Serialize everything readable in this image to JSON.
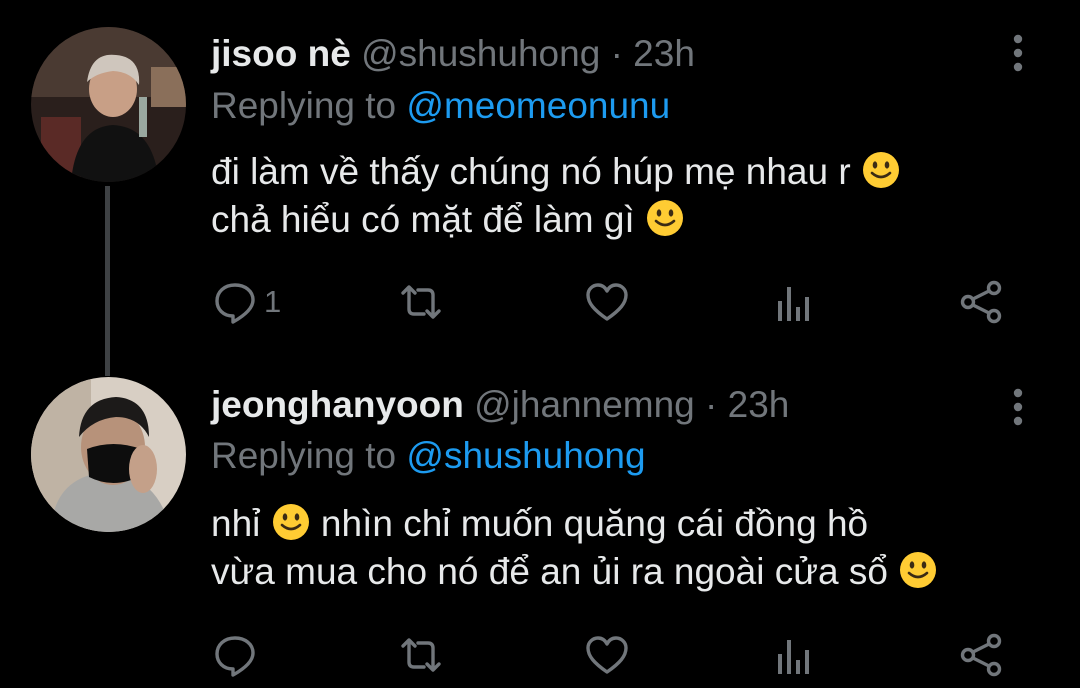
{
  "tweets": [
    {
      "name": "jisoo nè",
      "handle": "@shushuhong",
      "separator": "·",
      "time": "23h",
      "replying_prefix": "Replying to ",
      "replying_to": "@meomeonunu",
      "line1": "đi làm về thấy chúng nó húp mẹ nhau r ",
      "line2": "chả hiểu có mặt để làm gì ",
      "reply_count": "1",
      "icons": [
        "more-vertical-icon",
        "reply-icon",
        "retweet-icon",
        "like-icon",
        "stats-icon",
        "share-icon",
        "slightly-smiling-face-emoji"
      ]
    },
    {
      "name": "jeonghanyoon",
      "handle": "@jhannemng",
      "separator": "·",
      "time": "23h",
      "replying_prefix": "Replying to ",
      "replying_to": "@shushuhong",
      "line1_a": "nhỉ ",
      "line1_b": " nhìn chỉ muốn quăng cái đồng hồ",
      "line2": "vừa mua cho nó để an ủi ra ngoài cửa sổ ",
      "reply_count": "",
      "icons": [
        "more-vertical-icon",
        "reply-icon",
        "retweet-icon",
        "like-icon",
        "stats-icon",
        "share-icon",
        "slightly-smiling-face-emoji"
      ]
    }
  ],
  "colors": {
    "background": "#000000",
    "text": "#e7e9ea",
    "secondary": "#71767b",
    "link": "#1d9bf0",
    "thread_line": "#3e4144"
  }
}
